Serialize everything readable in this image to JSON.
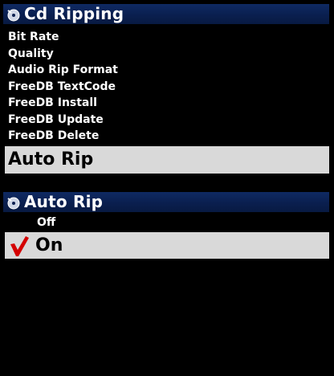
{
  "menu_panel": {
    "title": "Cd Ripping",
    "title_icon": "disc-icon",
    "items": [
      {
        "label": "Bit Rate"
      },
      {
        "label": "Quality"
      },
      {
        "label": "Audio Rip Format"
      },
      {
        "label": "FreeDB TextCode"
      },
      {
        "label": "FreeDB Install"
      },
      {
        "label": "FreeDB Update"
      },
      {
        "label": "FreeDB Delete"
      }
    ],
    "selected_item": "Auto Rip"
  },
  "submenu_panel": {
    "title": "Auto Rip",
    "title_icon": "disc-icon",
    "options": [
      {
        "label": "Off",
        "selected": false
      },
      {
        "label": "On",
        "selected": true
      }
    ],
    "selected_marker_icon": "checkmark-icon"
  },
  "colors": {
    "background": "#000000",
    "titlebar": "#0a1f4f",
    "highlight": "#d9d9d9",
    "checkmark": "#d40000",
    "text_light": "#ffffff",
    "text_dark": "#000000"
  }
}
